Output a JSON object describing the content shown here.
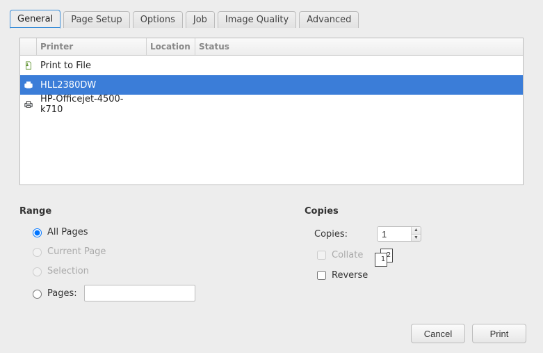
{
  "tabs": [
    {
      "label": "General",
      "active": true
    },
    {
      "label": "Page Setup",
      "active": false
    },
    {
      "label": "Options",
      "active": false
    },
    {
      "label": "Job",
      "active": false
    },
    {
      "label": "Image Quality",
      "active": false
    },
    {
      "label": "Advanced",
      "active": false
    }
  ],
  "printer_table": {
    "headers": {
      "printer": "Printer",
      "location": "Location",
      "status": "Status"
    },
    "rows": [
      {
        "icon": "print-to-file-icon",
        "name": "Print to File",
        "location": "",
        "status": "",
        "selected": false
      },
      {
        "icon": "printer-icon",
        "name": "HLL2380DW",
        "location": "",
        "status": "",
        "selected": true
      },
      {
        "icon": "printer-icon",
        "name": "HP-Officejet-4500-k710",
        "location": "",
        "status": "",
        "selected": false
      }
    ]
  },
  "range": {
    "title": "Range",
    "options": {
      "all": {
        "label": "All Pages",
        "checked": true,
        "enabled": true
      },
      "current": {
        "label": "Current Page",
        "checked": false,
        "enabled": false
      },
      "selection": {
        "label": "Selection",
        "checked": false,
        "enabled": false
      },
      "pages": {
        "label": "Pages:",
        "checked": false,
        "enabled": true,
        "value": ""
      }
    }
  },
  "copies": {
    "title": "Copies",
    "count_label": "Copies:",
    "count_value": "1",
    "collate": {
      "label": "Collate",
      "checked": false,
      "enabled": false
    },
    "reverse": {
      "label": "Reverse",
      "checked": false,
      "enabled": true
    }
  },
  "buttons": {
    "cancel": "Cancel",
    "print": "Print"
  }
}
